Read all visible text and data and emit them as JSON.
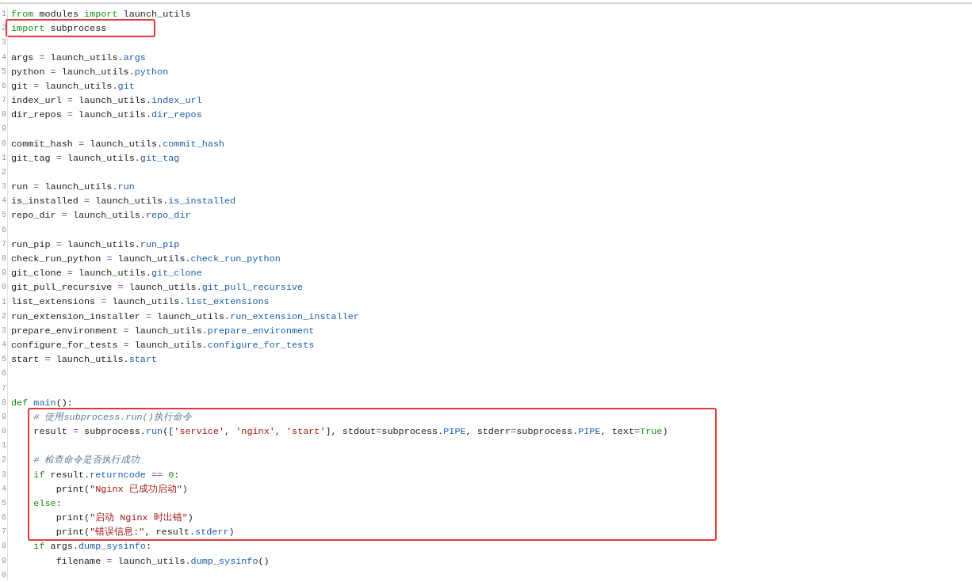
{
  "blocks": [
    {
      "boxed": false,
      "lines": [
        {
          "number": "1",
          "tokens": [
            {
              "text": "from",
              "kind": "kw"
            },
            {
              "text": " modules ",
              "kind": "plain"
            },
            {
              "text": "import",
              "kind": "kw"
            },
            {
              "text": " launch_utils",
              "kind": "plain"
            }
          ]
        }
      ]
    },
    {
      "boxed": true,
      "lines": [
        {
          "number": "2",
          "tokens": [
            {
              "text": "import",
              "kind": "kw"
            },
            {
              "text": " subprocess",
              "kind": "plain"
            }
          ]
        }
      ]
    },
    {
      "boxed": false,
      "lines": [
        {
          "number": "3"
        },
        {
          "number": "4",
          "tokens": [
            {
              "text": "args ",
              "kind": "plain"
            },
            {
              "text": "=",
              "kind": "op"
            },
            {
              "text": " launch_utils.",
              "kind": "plain"
            },
            {
              "text": "args",
              "kind": "attr"
            }
          ]
        },
        {
          "number": "5",
          "tokens": [
            {
              "text": "python ",
              "kind": "plain"
            },
            {
              "text": "=",
              "kind": "op"
            },
            {
              "text": " launch_utils.",
              "kind": "plain"
            },
            {
              "text": "python",
              "kind": "attr"
            }
          ]
        },
        {
          "number": "6",
          "tokens": [
            {
              "text": "git ",
              "kind": "plain"
            },
            {
              "text": "=",
              "kind": "op"
            },
            {
              "text": " launch_utils.",
              "kind": "plain"
            },
            {
              "text": "git",
              "kind": "attr"
            }
          ]
        },
        {
          "number": "7",
          "tokens": [
            {
              "text": "index_url ",
              "kind": "plain"
            },
            {
              "text": "=",
              "kind": "op"
            },
            {
              "text": " launch_utils.",
              "kind": "plain"
            },
            {
              "text": "index_url",
              "kind": "attr"
            }
          ]
        },
        {
          "number": "8",
          "tokens": [
            {
              "text": "dir_repos ",
              "kind": "plain"
            },
            {
              "text": "=",
              "kind": "op"
            },
            {
              "text": " launch_utils.",
              "kind": "plain"
            },
            {
              "text": "dir_repos",
              "kind": "attr"
            }
          ]
        },
        {
          "number": "9"
        },
        {
          "number": "0",
          "tokens": [
            {
              "text": "commit_hash ",
              "kind": "plain"
            },
            {
              "text": "=",
              "kind": "op"
            },
            {
              "text": " launch_utils.",
              "kind": "plain"
            },
            {
              "text": "commit_hash",
              "kind": "attr"
            }
          ]
        },
        {
          "number": "1",
          "tokens": [
            {
              "text": "git_tag ",
              "kind": "plain"
            },
            {
              "text": "=",
              "kind": "op"
            },
            {
              "text": " launch_utils.",
              "kind": "plain"
            },
            {
              "text": "git_tag",
              "kind": "attr"
            }
          ]
        },
        {
          "number": "2"
        },
        {
          "number": "3",
          "tokens": [
            {
              "text": "run ",
              "kind": "plain"
            },
            {
              "text": "=",
              "kind": "op"
            },
            {
              "text": " launch_utils.",
              "kind": "plain"
            },
            {
              "text": "run",
              "kind": "attr"
            }
          ]
        },
        {
          "number": "4",
          "tokens": [
            {
              "text": "is_installed ",
              "kind": "plain"
            },
            {
              "text": "=",
              "kind": "op"
            },
            {
              "text": " launch_utils.",
              "kind": "plain"
            },
            {
              "text": "is_installed",
              "kind": "attr"
            }
          ]
        },
        {
          "number": "5",
          "tokens": [
            {
              "text": "repo_dir ",
              "kind": "plain"
            },
            {
              "text": "=",
              "kind": "op"
            },
            {
              "text": " launch_utils.",
              "kind": "plain"
            },
            {
              "text": "repo_dir",
              "kind": "attr"
            }
          ]
        },
        {
          "number": "6"
        },
        {
          "number": "7",
          "tokens": [
            {
              "text": "run_pip ",
              "kind": "plain"
            },
            {
              "text": "=",
              "kind": "op"
            },
            {
              "text": " launch_utils.",
              "kind": "plain"
            },
            {
              "text": "run_pip",
              "kind": "attr"
            }
          ]
        },
        {
          "number": "8",
          "tokens": [
            {
              "text": "check_run_python ",
              "kind": "plain"
            },
            {
              "text": "=",
              "kind": "op"
            },
            {
              "text": " launch_utils.",
              "kind": "plain"
            },
            {
              "text": "check_run_python",
              "kind": "attr"
            }
          ]
        },
        {
          "number": "9",
          "tokens": [
            {
              "text": "git_clone ",
              "kind": "plain"
            },
            {
              "text": "=",
              "kind": "op"
            },
            {
              "text": " launch_utils.",
              "kind": "plain"
            },
            {
              "text": "git_clone",
              "kind": "attr"
            }
          ]
        },
        {
          "number": "0",
          "tokens": [
            {
              "text": "git_pull_recursive ",
              "kind": "plain"
            },
            {
              "text": "=",
              "kind": "op"
            },
            {
              "text": " launch_utils.",
              "kind": "plain"
            },
            {
              "text": "git_pull_recursive",
              "kind": "attr"
            }
          ]
        },
        {
          "number": "1",
          "tokens": [
            {
              "text": "list_extensions ",
              "kind": "plain"
            },
            {
              "text": "=",
              "kind": "op"
            },
            {
              "text": " launch_utils.",
              "kind": "plain"
            },
            {
              "text": "list_extensions",
              "kind": "attr"
            }
          ]
        },
        {
          "number": "2",
          "tokens": [
            {
              "text": "run_extension_installer ",
              "kind": "plain"
            },
            {
              "text": "=",
              "kind": "op"
            },
            {
              "text": " launch_utils.",
              "kind": "plain"
            },
            {
              "text": "run_extension_installer",
              "kind": "attr"
            }
          ]
        },
        {
          "number": "3",
          "tokens": [
            {
              "text": "prepare_environment ",
              "kind": "plain"
            },
            {
              "text": "=",
              "kind": "op"
            },
            {
              "text": " launch_utils.",
              "kind": "plain"
            },
            {
              "text": "prepare_environment",
              "kind": "attr"
            }
          ]
        },
        {
          "number": "4",
          "tokens": [
            {
              "text": "configure_for_tests ",
              "kind": "plain"
            },
            {
              "text": "=",
              "kind": "op"
            },
            {
              "text": " launch_utils.",
              "kind": "plain"
            },
            {
              "text": "configure_for_tests",
              "kind": "attr"
            }
          ]
        },
        {
          "number": "5",
          "tokens": [
            {
              "text": "start ",
              "kind": "plain"
            },
            {
              "text": "=",
              "kind": "op"
            },
            {
              "text": " launch_utils.",
              "kind": "plain"
            },
            {
              "text": "start",
              "kind": "attr"
            }
          ]
        },
        {
          "number": "6"
        },
        {
          "number": "7"
        },
        {
          "number": "8",
          "tokens": [
            {
              "text": "def",
              "kind": "kw"
            },
            {
              "text": " main",
              "kind": "attr"
            },
            {
              "text": "():",
              "kind": "plain"
            }
          ]
        }
      ]
    },
    {
      "boxed": true,
      "lines": [
        {
          "number": "9",
          "tokens": [
            {
              "text": "    # 使用subprocess.run()执行命令",
              "kind": "comment"
            }
          ]
        },
        {
          "number": "0",
          "tokens": [
            {
              "text": "    result ",
              "kind": "plain"
            },
            {
              "text": "=",
              "kind": "op"
            },
            {
              "text": " subprocess.",
              "kind": "plain"
            },
            {
              "text": "run",
              "kind": "attr"
            },
            {
              "text": "([",
              "kind": "plain"
            },
            {
              "text": "'service'",
              "kind": "str"
            },
            {
              "text": ", ",
              "kind": "plain"
            },
            {
              "text": "'nginx'",
              "kind": "str"
            },
            {
              "text": ", ",
              "kind": "plain"
            },
            {
              "text": "'start'",
              "kind": "str"
            },
            {
              "text": "], stdout",
              "kind": "plain"
            },
            {
              "text": "=",
              "kind": "op"
            },
            {
              "text": "subprocess.",
              "kind": "plain"
            },
            {
              "text": "PIPE",
              "kind": "attr"
            },
            {
              "text": ", stderr",
              "kind": "plain"
            },
            {
              "text": "=",
              "kind": "op"
            },
            {
              "text": "subprocess.",
              "kind": "plain"
            },
            {
              "text": "PIPE",
              "kind": "attr"
            },
            {
              "text": ", text",
              "kind": "plain"
            },
            {
              "text": "=",
              "kind": "op"
            },
            {
              "text": "True",
              "kind": "kw"
            },
            {
              "text": ")",
              "kind": "plain"
            }
          ]
        },
        {
          "number": "1"
        },
        {
          "number": "2",
          "tokens": [
            {
              "text": "    # 检查命令是否执行成功",
              "kind": "comment"
            }
          ]
        },
        {
          "number": "3",
          "tokens": [
            {
              "text": "    if",
              "kind": "kw"
            },
            {
              "text": " result.",
              "kind": "plain"
            },
            {
              "text": "returncode",
              "kind": "attr"
            },
            {
              "text": " ==",
              "kind": "op"
            },
            {
              "text": " 0",
              "kind": "num"
            },
            {
              "text": ":",
              "kind": "plain"
            }
          ]
        },
        {
          "number": "4",
          "tokens": [
            {
              "text": "        print(",
              "kind": "plain"
            },
            {
              "text": "\"Nginx 已成功启动\"",
              "kind": "str"
            },
            {
              "text": ")",
              "kind": "plain"
            }
          ]
        },
        {
          "number": "5",
          "tokens": [
            {
              "text": "    else",
              "kind": "kw"
            },
            {
              "text": ":",
              "kind": "plain"
            }
          ]
        },
        {
          "number": "6",
          "tokens": [
            {
              "text": "        print(",
              "kind": "plain"
            },
            {
              "text": "\"启动 Nginx 时出错\"",
              "kind": "str"
            },
            {
              "text": ")",
              "kind": "plain"
            }
          ]
        },
        {
          "number": "7",
          "tokens": [
            {
              "text": "        print(",
              "kind": "plain"
            },
            {
              "text": "\"错误信息:\"",
              "kind": "str"
            },
            {
              "text": ", result.",
              "kind": "plain"
            },
            {
              "text": "stderr",
              "kind": "attr"
            },
            {
              "text": ")",
              "kind": "plain"
            }
          ]
        }
      ]
    },
    {
      "boxed": false,
      "lines": [
        {
          "number": "8",
          "tokens": [
            {
              "text": "    if",
              "kind": "kw"
            },
            {
              "text": " args.",
              "kind": "plain"
            },
            {
              "text": "dump_sysinfo",
              "kind": "attr"
            },
            {
              "text": ":",
              "kind": "plain"
            }
          ]
        },
        {
          "number": "9",
          "tokens": [
            {
              "text": "        filename ",
              "kind": "plain"
            },
            {
              "text": "=",
              "kind": "op"
            },
            {
              "text": " launch_utils.",
              "kind": "plain"
            },
            {
              "text": "dump_sysinfo",
              "kind": "attr"
            },
            {
              "text": "()",
              "kind": "plain"
            }
          ]
        },
        {
          "number": "0"
        }
      ]
    }
  ]
}
